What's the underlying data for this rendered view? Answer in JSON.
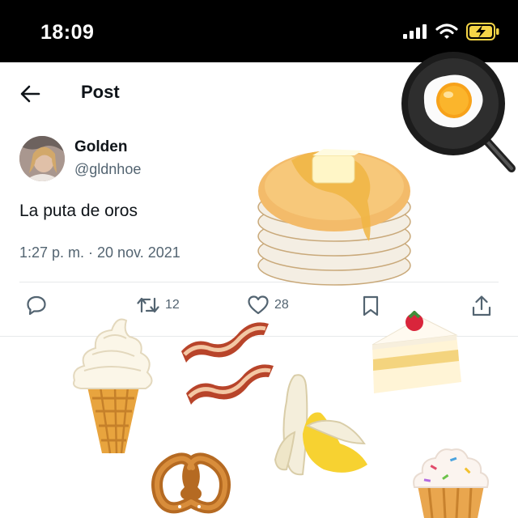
{
  "status_bar": {
    "time": "18:09"
  },
  "header": {
    "title": "Post"
  },
  "post": {
    "author_name": "Golden",
    "author_handle": "@gldnhoe",
    "text": "La puta de oros",
    "timestamp": "1:27 p. m. · 20 nov. 2021"
  },
  "actions": {
    "reposts": "12",
    "likes": "28"
  },
  "stickers": [
    "fried-egg-pan",
    "pancakes",
    "ice-cream-cone",
    "bacon",
    "strawberry-cake-slice",
    "banana",
    "pretzel",
    "cupcake"
  ],
  "colors": {
    "text": "#0f1419",
    "secondary": "#536471",
    "divider": "#e7e9ea",
    "statusbar": "#000000",
    "battery": "#f5d547"
  }
}
